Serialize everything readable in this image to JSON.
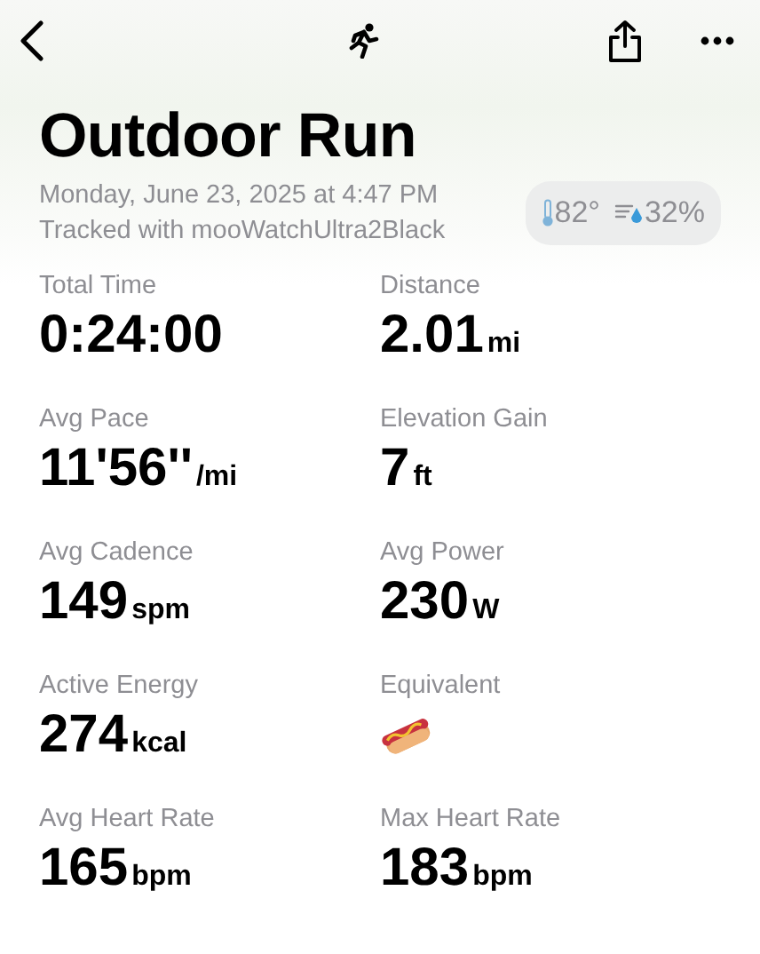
{
  "title": "Outdoor Run",
  "date": "Monday, June 23, 2025 at 4:47 PM",
  "source": "Tracked with mooWatchUltra2Black",
  "weather": {
    "temperature": "82°",
    "humidity": "32%"
  },
  "metrics": [
    {
      "kind": "value",
      "label": "Total Time",
      "value": "0:24:00"
    },
    {
      "kind": "value",
      "label": "Distance",
      "value": "2.01",
      "unit": "mi"
    },
    {
      "kind": "value",
      "label": "Avg Pace",
      "value": "11'56''",
      "unit": "/mi"
    },
    {
      "kind": "value",
      "label": "Elevation Gain",
      "value": "7",
      "unit": "ft"
    },
    {
      "kind": "value",
      "label": "Avg Cadence",
      "value": "149",
      "unit": "spm"
    },
    {
      "kind": "value",
      "label": "Avg Power",
      "value": "230",
      "unit": "W"
    },
    {
      "kind": "value",
      "label": "Active Energy",
      "value": "274",
      "unit": "kcal"
    },
    {
      "kind": "food",
      "label": "Equivalent"
    },
    {
      "kind": "value",
      "label": "Avg Heart Rate",
      "value": "165",
      "unit": "bpm"
    },
    {
      "kind": "value",
      "label": "Max Heart Rate",
      "value": "183",
      "unit": "bpm"
    }
  ]
}
